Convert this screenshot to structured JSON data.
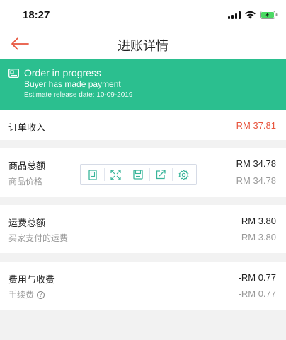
{
  "status_bar": {
    "time": "18:27"
  },
  "nav": {
    "title": "进账详情"
  },
  "banner": {
    "title": "Order in progress",
    "subtitle": "Buyer has made payment",
    "release": "Estimate release date: 10-09-2019"
  },
  "order_income": {
    "label": "订单收入",
    "value": "RM 37.81"
  },
  "goods_total": {
    "label": "商品总额",
    "sub_label": "商品价格",
    "value": "RM 34.78",
    "sub_value": "RM 34.78"
  },
  "shipping_total": {
    "label": "运费总额",
    "sub_label": "买家支付的运费",
    "value": "RM 3.80",
    "sub_value": "RM 3.80"
  },
  "fees": {
    "label": "费用与收费",
    "sub_label": "手续费",
    "value": "-RM 0.77",
    "sub_value": "-RM 0.77"
  },
  "colors": {
    "accent": "#e8553e",
    "banner": "#2bbf8f",
    "background": "#f2f2f2",
    "toolbar_icon": "#39b59a"
  },
  "toolbar": {
    "icons": [
      "copy-icon",
      "expand-icon",
      "save-icon",
      "share-icon",
      "settings-icon"
    ]
  }
}
